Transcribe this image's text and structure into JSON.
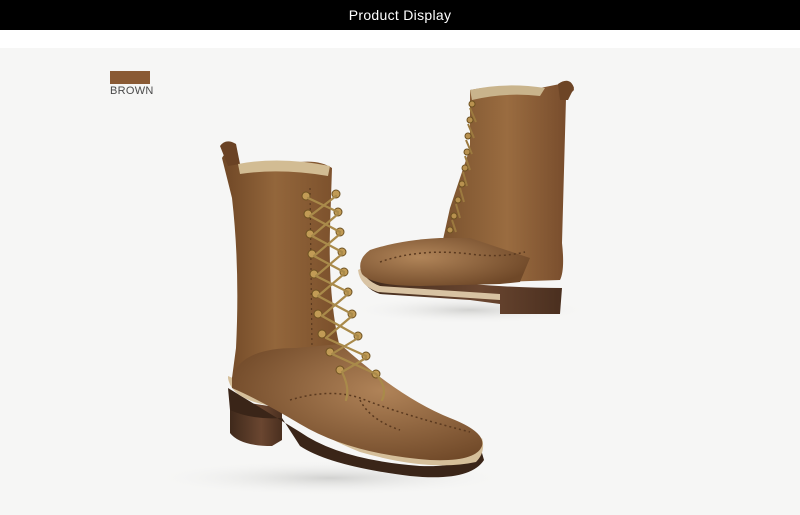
{
  "header": {
    "title": "Product Display",
    "background": "#000000",
    "text_color": "#ffffff"
  },
  "color_swatch": {
    "label": "BROWN",
    "color": "#8a5a34"
  },
  "product_image": {
    "icon": "boot-photo",
    "items": [
      "front-boot",
      "back-boot"
    ],
    "primary_color": "#8b5e35",
    "sole_color": "#4f3322"
  }
}
